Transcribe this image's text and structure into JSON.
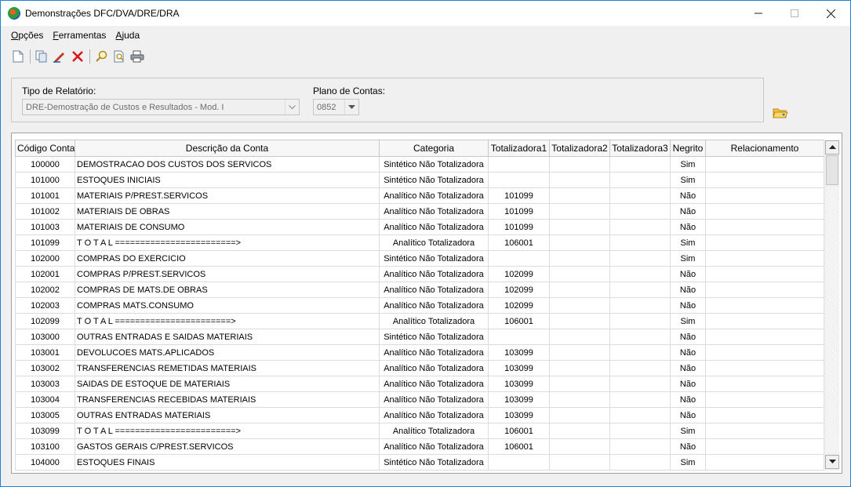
{
  "window": {
    "title": "Demonstrações DFC/DVA/DRE/DRA"
  },
  "menu": [
    {
      "accel": "O",
      "rest": "pções"
    },
    {
      "accel": "F",
      "rest": "erramentas"
    },
    {
      "accel": "A",
      "rest": "juda"
    }
  ],
  "filters": {
    "tipo_label": "Tipo de Relatório:",
    "tipo_value": "DRE-Demostração de Custos e Resultados - Mod. I",
    "plano_label": "Plano de Contas:",
    "plano_value": "0852"
  },
  "grid": {
    "columns": [
      "Código Conta",
      "Descrição da Conta",
      "Categoria",
      "Totalizadora1",
      "Totalizadora2",
      "Totalizadora3",
      "Negrito",
      "Relacionamento"
    ],
    "rows": [
      [
        "100000",
        "DEMOSTRACAO DOS CUSTOS DOS SERVICOS",
        "Sintético Não Totalizadora",
        "",
        "",
        "",
        "Sim",
        ""
      ],
      [
        "101000",
        "ESTOQUES INICIAIS",
        "Sintético Não Totalizadora",
        "",
        "",
        "",
        "Sim",
        ""
      ],
      [
        "101001",
        "MATERIAIS P/PREST.SERVICOS",
        "Analítico Não Totalizadora",
        "101099",
        "",
        "",
        "Não",
        ""
      ],
      [
        "101002",
        "MATERIAIS DE OBRAS",
        "Analítico Não Totalizadora",
        "101099",
        "",
        "",
        "Não",
        ""
      ],
      [
        "101003",
        "MATERIAIS DE CONSUMO",
        "Analítico Não Totalizadora",
        "101099",
        "",
        "",
        "Não",
        ""
      ],
      [
        "101099",
        "T O T A L ========================>",
        "Analítico Totalizadora",
        "106001",
        "",
        "",
        "Sim",
        ""
      ],
      [
        "102000",
        "COMPRAS DO EXERCICIO",
        "Sintético Não Totalizadora",
        "",
        "",
        "",
        "Sim",
        ""
      ],
      [
        "102001",
        "COMPRAS P/PREST.SERVICOS",
        "Analítico Não Totalizadora",
        "102099",
        "",
        "",
        "Não",
        ""
      ],
      [
        "102002",
        "COMPRAS DE MATS.DE OBRAS",
        "Analítico Não Totalizadora",
        "102099",
        "",
        "",
        "Não",
        ""
      ],
      [
        "102003",
        "COMPRAS MATS.CONSUMO",
        "Analítico Não Totalizadora",
        "102099",
        "",
        "",
        "Não",
        ""
      ],
      [
        "102099",
        "T O T A L =======================>",
        "Analítico Totalizadora",
        "106001",
        "",
        "",
        "Sim",
        ""
      ],
      [
        "103000",
        "OUTRAS ENTRADAS E SAIDAS MATERIAIS",
        "Sintético Não Totalizadora",
        "",
        "",
        "",
        "Não",
        ""
      ],
      [
        "103001",
        "DEVOLUCOES MATS.APLICADOS",
        "Analítico Não Totalizadora",
        "103099",
        "",
        "",
        "Não",
        ""
      ],
      [
        "103002",
        "TRANSFERENCIAS REMETIDAS MATERIAIS",
        "Analítico Não Totalizadora",
        "103099",
        "",
        "",
        "Não",
        ""
      ],
      [
        "103003",
        "SAIDAS DE ESTOQUE DE MATERIAIS",
        "Analítico Não Totalizadora",
        "103099",
        "",
        "",
        "Não",
        ""
      ],
      [
        "103004",
        "TRANSFERENCIAS RECEBIDAS MATERIAIS",
        "Analítico Não Totalizadora",
        "103099",
        "",
        "",
        "Não",
        ""
      ],
      [
        "103005",
        "OUTRAS ENTRADAS MATERIAIS",
        "Analítico Não Totalizadora",
        "103099",
        "",
        "",
        "Não",
        ""
      ],
      [
        "103099",
        "T O T A L ========================>",
        "Analítico Totalizadora",
        "106001",
        "",
        "",
        "Sim",
        ""
      ],
      [
        "103100",
        "GASTOS GERAIS C/PREST.SERVICOS",
        "Analítico Não Totalizadora",
        "106001",
        "",
        "",
        "Não",
        ""
      ],
      [
        "104000",
        "ESTOQUES FINAIS",
        "Sintético Não Totalizadora",
        "",
        "",
        "",
        "Sim",
        ""
      ]
    ]
  }
}
